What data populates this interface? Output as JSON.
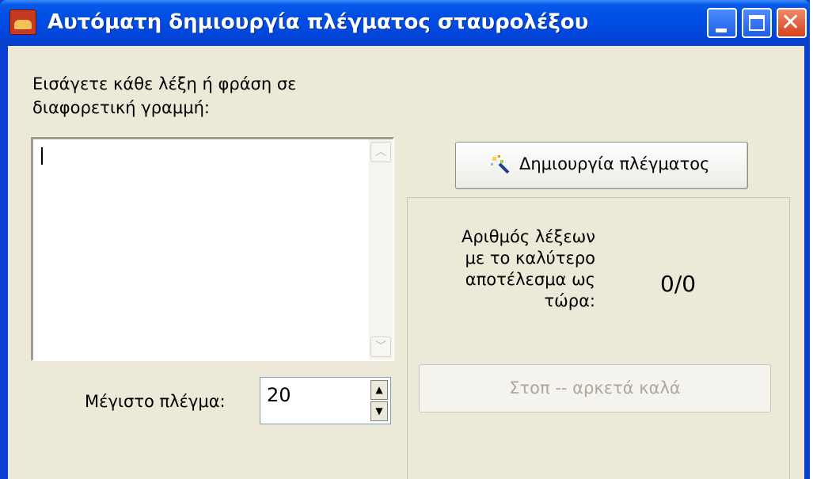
{
  "window": {
    "title": "Αυτόματη δημιουργία πλέγματος σταυρολέξου",
    "app_icon": "app-icon",
    "controls": [
      "minimize-icon",
      "maximize-icon",
      "close-icon"
    ]
  },
  "input": {
    "label": "Εισάγετε κάθε λέξη ή φράση σε διαφορετική γραμμή:",
    "value": ""
  },
  "max_grid": {
    "label": "Μέγιστο πλέγμα:",
    "value": "20"
  },
  "create_button": {
    "label": "Δημιουργία πλέγματος",
    "icon": "magic-wand-icon"
  },
  "result": {
    "label": "Αριθμός λέξεων με το καλύτερο αποτέλεσμα ως τώρα:",
    "value": "0/0"
  },
  "stop_button": {
    "label": "Στοπ -- αρκετά καλά",
    "enabled": false
  },
  "colors": {
    "titlebar": "#0050e6",
    "client_bg": "#ece9d8",
    "disabled_text": "#aca899"
  }
}
